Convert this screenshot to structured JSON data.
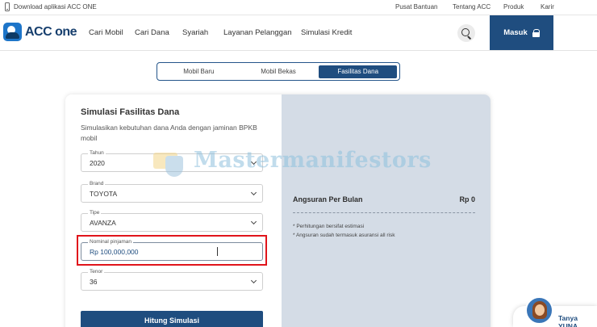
{
  "topbar": {
    "download_text": "Download aplikasi ACC ONE",
    "links": [
      "Pusat Bantuan",
      "Tentang ACC",
      "Produk",
      "Karir"
    ]
  },
  "nav": {
    "logo_text": "ACC one",
    "items": [
      "Cari Mobil",
      "Cari Dana",
      "Syariah",
      "Layanan Pelanggan",
      "Simulasi Kredit"
    ],
    "login_label": "Masuk"
  },
  "tabs": [
    {
      "label": "Mobil Baru",
      "active": false
    },
    {
      "label": "Mobil Bekas",
      "active": false
    },
    {
      "label": "Fasilitas Dana",
      "active": true
    }
  ],
  "form": {
    "title": "Simulasi Fasilitas Dana",
    "description": "Simulasikan kebutuhan dana Anda dengan jaminan BPKB mobil",
    "fields": {
      "tahun": {
        "label": "Tahun",
        "value": "2020"
      },
      "brand": {
        "label": "Brand",
        "value": "TOYOTA"
      },
      "tipe": {
        "label": "Tipe",
        "value": "AVANZA"
      },
      "nominal": {
        "label": "Nominal pinjaman",
        "value": "Rp 100,000,000"
      },
      "tenor": {
        "label": "Tenor",
        "value": "36"
      }
    },
    "submit_label": "Hitung Simulasi"
  },
  "result": {
    "label": "Angsuran Per Bulan",
    "value": "Rp 0",
    "notes": [
      "* Perhitungan bersifat estimasi",
      "* Angsuran sudah termasuk asuransi all risk"
    ]
  },
  "watermark": "Mastermanifestors",
  "chat": {
    "label": "Tanya YUNA"
  },
  "colors": {
    "primary": "#1f4d7f",
    "highlight": "#e0141b",
    "panel": "#d4dce6"
  }
}
